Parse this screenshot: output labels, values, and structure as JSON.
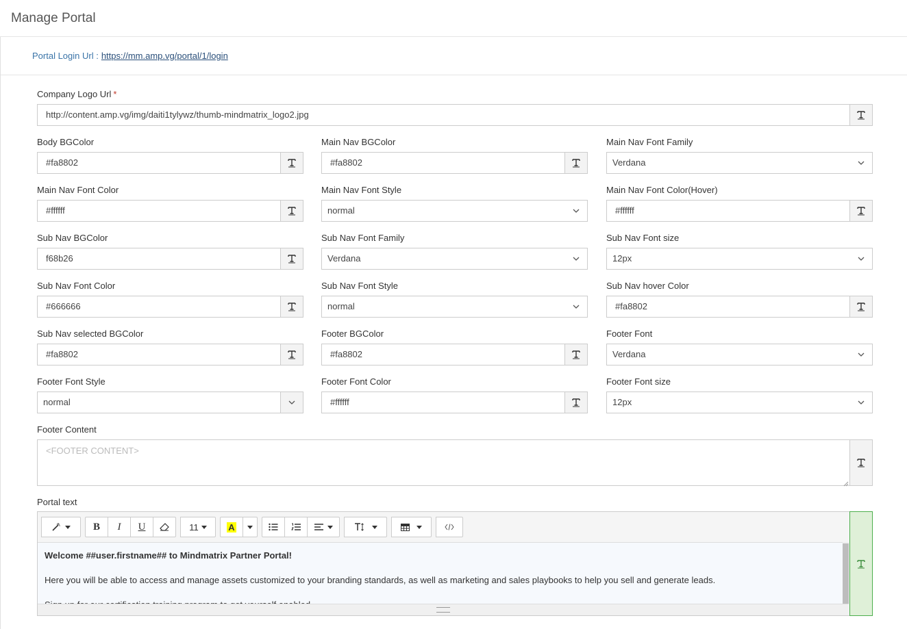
{
  "header": {
    "title": "Manage Portal"
  },
  "portal": {
    "label": "Portal Login Url :",
    "url": "https://mm.amp.vg/portal/1/login"
  },
  "company_logo": {
    "label": "Company Logo Url",
    "required_mark": "*",
    "value": "http://content.amp.vg/img/daiti1tylywz/thumb-mindmatrix_logo2.jpg"
  },
  "fields": {
    "body_bgcolor": {
      "label": "Body BGColor",
      "value": "#fa8802"
    },
    "main_nav_bgcolor": {
      "label": "Main Nav BGColor",
      "value": "#fa8802"
    },
    "main_nav_font_family": {
      "label": "Main Nav Font Family",
      "value": "Verdana"
    },
    "main_nav_font_color": {
      "label": "Main Nav Font Color",
      "value": "#ffffff"
    },
    "main_nav_font_style": {
      "label": "Main Nav Font Style",
      "value": "normal"
    },
    "main_nav_font_color_hover": {
      "label": "Main Nav Font Color(Hover)",
      "value": "#ffffff"
    },
    "sub_nav_bgcolor": {
      "label": "Sub Nav BGColor",
      "value": "f68b26"
    },
    "sub_nav_font_family": {
      "label": "Sub Nav Font Family",
      "value": "Verdana"
    },
    "sub_nav_font_size": {
      "label": "Sub Nav Font size",
      "value": "12px"
    },
    "sub_nav_font_color": {
      "label": "Sub Nav Font Color",
      "value": "#666666"
    },
    "sub_nav_font_style": {
      "label": "Sub Nav Font Style",
      "value": "normal"
    },
    "sub_nav_hover_color": {
      "label": "Sub Nav hover Color",
      "value": "#fa8802"
    },
    "sub_nav_selected_bgcolor": {
      "label": "Sub Nav selected BGColor",
      "value": "#fa8802"
    },
    "footer_bgcolor": {
      "label": "Footer BGColor",
      "value": "#fa8802"
    },
    "footer_font": {
      "label": "Footer Font",
      "value": "Verdana"
    },
    "footer_font_style": {
      "label": "Footer Font Style",
      "value": "normal"
    },
    "footer_font_color": {
      "label": "Footer Font Color",
      "value": "#ffffff"
    },
    "footer_font_size": {
      "label": "Footer Font size",
      "value": "12px"
    }
  },
  "footer_content": {
    "label": "Footer Content",
    "placeholder": "<FOOTER CONTENT>"
  },
  "portal_text": {
    "label": "Portal text",
    "font_size": "11",
    "font_size_caret": "",
    "paragraphs": [
      "Welcome  ##user.firstname## to Mindmatrix Partner Portal!",
      "Here you will be able to access and manage assets customized to your branding standards, as well as marketing and sales playbooks to help you sell and generate leads.",
      "Sign up for our certification training program to get yourself enabled."
    ]
  },
  "icons": {
    "text_token": "text-token-icon",
    "chevron": "chevron-down-icon"
  },
  "colors": {
    "accent_link": "#3a74a8",
    "required": "#c0392b",
    "active_addon_bg": "#dff0d8",
    "active_addon_border": "#4cae4c"
  }
}
